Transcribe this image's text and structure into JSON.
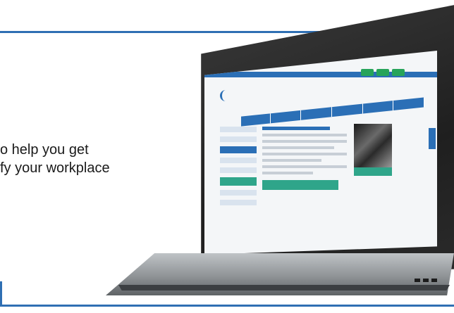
{
  "promo": {
    "line1": "o help you get",
    "line2": "fy your workplace"
  },
  "colors": {
    "frame_blue": "#2f6fb3",
    "site_blue": "#2b6fb6",
    "site_green": "#2fa58a"
  },
  "icons": [
    "laptop-icon"
  ]
}
